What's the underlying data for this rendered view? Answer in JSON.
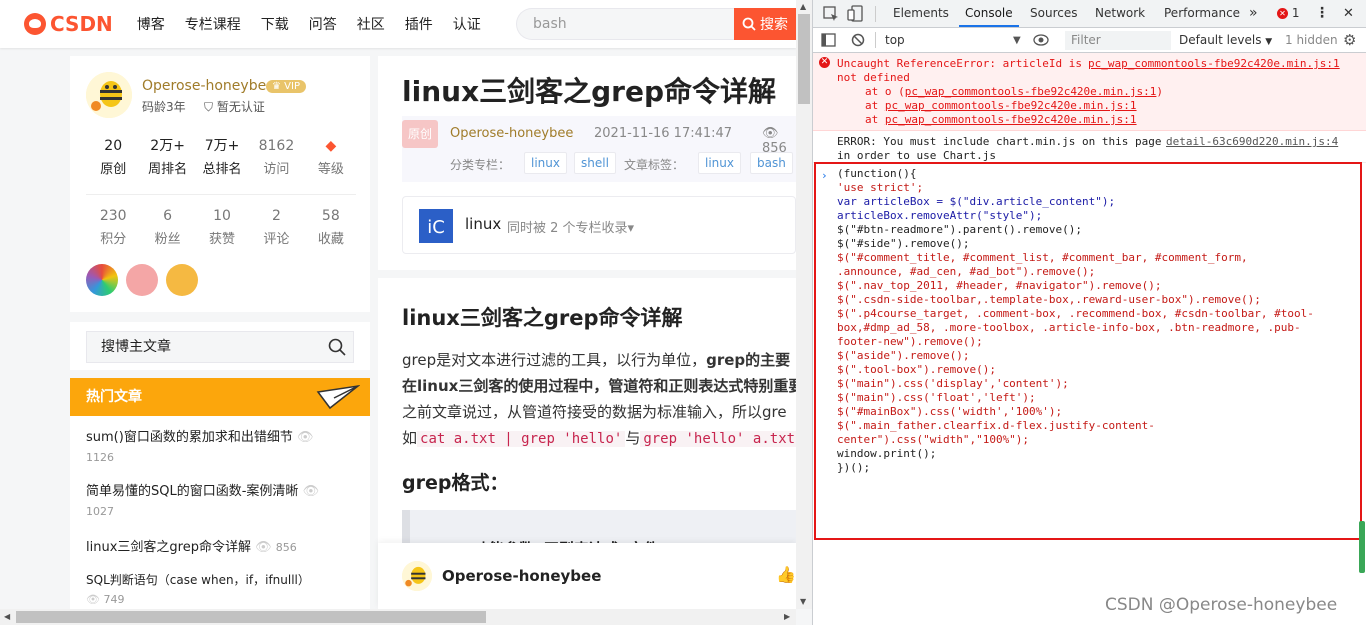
{
  "site": {
    "logo_text": "CSDN",
    "nav": [
      "博客",
      "专栏课程",
      "下载",
      "问答",
      "社区",
      "插件",
      "认证"
    ],
    "search_placeholder": "bash",
    "search_button": "搜索"
  },
  "profile": {
    "username": "Operose-honeybee",
    "vip": "VIP",
    "code_age": "码龄3年",
    "cert": "暂无认证",
    "stats_row1": [
      {
        "value": "20",
        "label": "原创"
      },
      {
        "value": "2万+",
        "label": "周排名"
      },
      {
        "value": "7万+",
        "label": "总排名"
      },
      {
        "value": "8162",
        "label": "访问"
      },
      {
        "value": "",
        "label": "等级"
      }
    ],
    "stats_row2": [
      {
        "value": "230",
        "label": "积分"
      },
      {
        "value": "6",
        "label": "粉丝"
      },
      {
        "value": "10",
        "label": "获赞"
      },
      {
        "value": "2",
        "label": "评论"
      },
      {
        "value": "58",
        "label": "收藏"
      }
    ]
  },
  "blog_search": {
    "placeholder": "搜博主文章"
  },
  "hot": {
    "heading": "热门文章",
    "items": [
      {
        "title": "sum()窗口函数的累加求和出错细节",
        "views": "1126"
      },
      {
        "title": "简单易懂的SQL的窗口函数-案例清晰",
        "views": "1027"
      },
      {
        "title": "linux三剑客之grep命令详解",
        "views": "856"
      },
      {
        "title": "SQL判断语句（case when，if，ifnulll）",
        "views": "749"
      }
    ]
  },
  "article": {
    "title": "linux三剑客之grep命令详解",
    "orig_tag": "原创",
    "author": "Operose-honeybee",
    "date": "2021-11-16 17:41:47",
    "views": "856",
    "column_label": "分类专栏：",
    "columns": [
      "linux",
      "shell"
    ],
    "tag_label": "文章标签：",
    "tags": [
      "linux",
      "bash"
    ],
    "collection_name": "linux",
    "collection_sub": "同时被 2 个专栏收录",
    "h2": "linux三剑客之grep命令详解",
    "p1a": "grep是对文本进行过滤的工具，以行为单位，",
    "p1b": "grep的主要",
    "p2": "在linux三剑客的使用过程中，管道符和正则表达式特别重要",
    "p3": "之前文章说过，从管道符接受的数据为标准输入，所以gre",
    "p4a": "如",
    "code1": "cat a.txt | grep 'hello'",
    "p4b": "与",
    "code2": "grep 'hello' a.txt",
    "h3": "grep格式：",
    "quote": "功能参数 '正则表达式' 文件",
    "bottom_author": "Operose-honeybee"
  },
  "devtools": {
    "tabs": [
      "Elements",
      "Console",
      "Sources",
      "Network",
      "Performance"
    ],
    "more": "»",
    "error_count": "1",
    "context": "top",
    "filter_placeholder": "Filter",
    "levels": "Default levels",
    "hidden": "1 hidden",
    "error": {
      "line1": "Uncaught ReferenceError: articleId is",
      "line1_link": "pc_wap_commontools-fbe92c420e.min.js:1",
      "line2": "not defined",
      "at1": "at o (",
      "at1_link": "pc_wap_commontools-fbe92c420e.min.js:1",
      "at1_end": ")",
      "at_prefix": "at ",
      "at2_link": "pc_wap_commontools-fbe92c420e.min.js:1",
      "at3_link": "pc_wap_commontools-fbe92c420e.min.js:1"
    },
    "log": {
      "line1": "ERROR: You must include chart.min.js on this page",
      "line1_link": "detail-63c690d220.min.js:4",
      "line2": "in order to use Chart.js"
    },
    "code_lines": [
      "(function(){",
      "    'use strict';",
      "    var articleBox = $(\"div.article_content\");",
      "    articleBox.removeAttr(\"style\");",
      "    $(\"#btn-readmore\").parent().remove();",
      "    $(\"#side\").remove();",
      "    $(\"#comment_title, #comment_list, #comment_bar, #comment_form,",
      ".announce, #ad_cen, #ad_bot\").remove();",
      "    $(\".nav_top_2011, #header, #navigator\").remove();",
      "    $(\".csdn-side-toolbar,.template-box,.reward-user-box\").remove();",
      "    $(\".p4course_target, .comment-box, .recommend-box, #csdn-toolbar, #tool-",
      "box,#dmp_ad_58, .more-toolbox, .article-info-box, .btn-readmore, .pub-",
      "footer-new\").remove();",
      "    $(\"aside\").remove();",
      "    $(\".tool-box\").remove();",
      "    $(\"main\").css('display','content');",
      "    $(\"main\").css('float','left');",
      "    $(\"#mainBox\").css('width','100%');",
      "    $(\".main_father.clearfix.d-flex.justify-content-",
      "center\").css(\"width\",\"100%\");",
      "    window.print();",
      "})();"
    ]
  },
  "watermark": "CSDN @Operose-honeybee"
}
